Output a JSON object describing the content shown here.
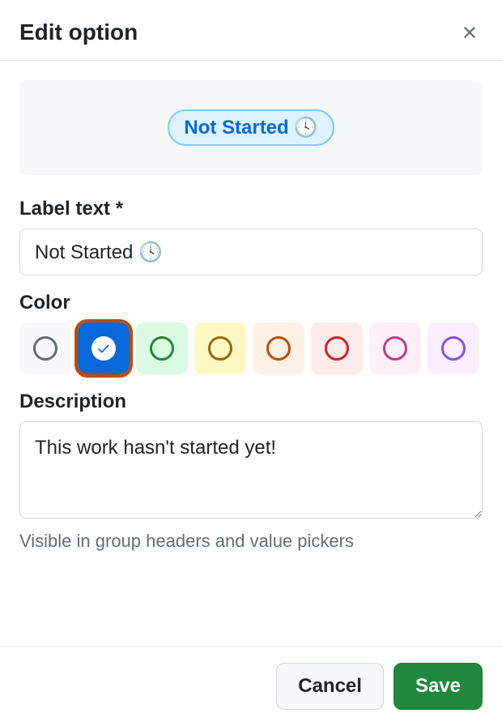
{
  "dialog": {
    "title": "Edit option"
  },
  "preview": {
    "label": "Not Started",
    "icon": "🕓"
  },
  "fields": {
    "labelText": {
      "label": "Label text *",
      "value": "Not Started 🕓"
    },
    "color": {
      "label": "Color",
      "options": [
        {
          "id": "gray",
          "name": "Gray",
          "hex": "#656d76",
          "bg": "#f6f8fa",
          "selected": false
        },
        {
          "id": "blue",
          "name": "Blue",
          "hex": "#0969da",
          "bg": "#0969da",
          "selected": true
        },
        {
          "id": "green",
          "name": "Green",
          "hex": "#1f883d",
          "bg": "#dafbe1",
          "selected": false
        },
        {
          "id": "yellow",
          "name": "Yellow",
          "hex": "#9a6700",
          "bg": "#fff8c5",
          "selected": false
        },
        {
          "id": "orange",
          "name": "Orange",
          "hex": "#bc4c00",
          "bg": "#fff1e5",
          "selected": false
        },
        {
          "id": "red",
          "name": "Red",
          "hex": "#cf222e",
          "bg": "#ffebe9",
          "selected": false
        },
        {
          "id": "pink",
          "name": "Pink",
          "hex": "#bf3989",
          "bg": "#ffeff7",
          "selected": false
        },
        {
          "id": "purple",
          "name": "Purple",
          "hex": "#8250df",
          "bg": "#fbefff",
          "selected": false
        }
      ]
    },
    "description": {
      "label": "Description",
      "value": "This work hasn't started yet!",
      "helper": "Visible in group headers and value pickers"
    }
  },
  "footer": {
    "cancel": "Cancel",
    "save": "Save"
  }
}
